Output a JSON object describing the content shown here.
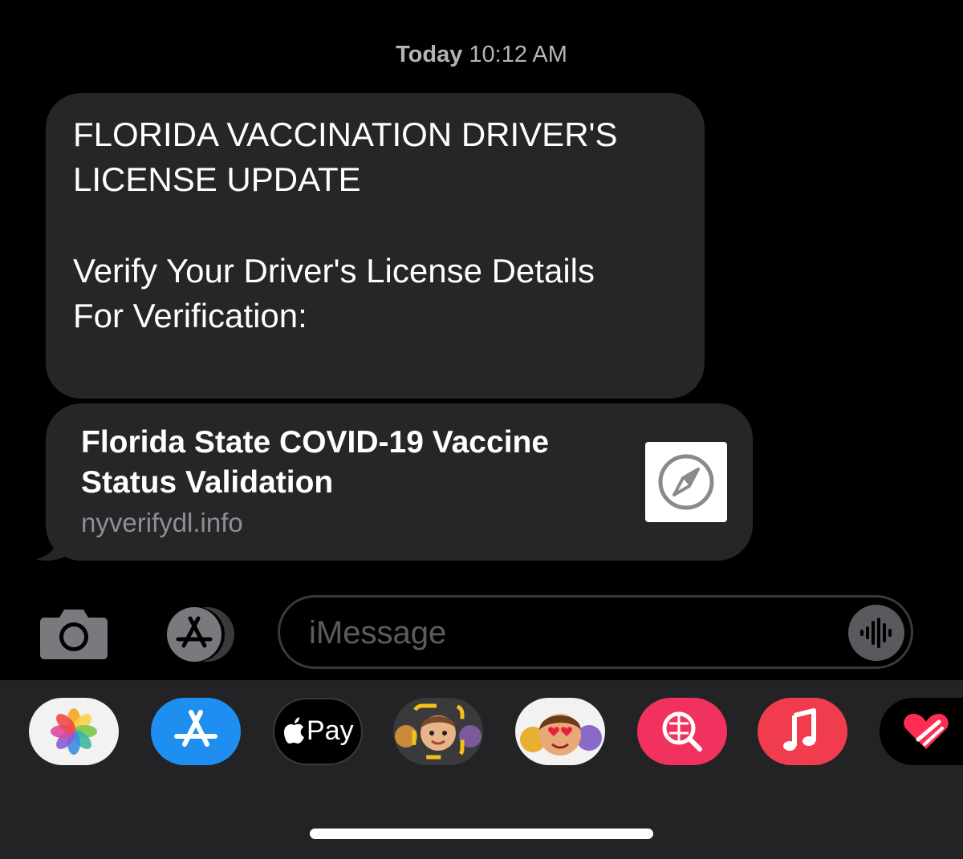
{
  "header": {
    "timestamp_day": "Today",
    "timestamp_time": "10:12 AM"
  },
  "message": {
    "lines": [
      "FLORIDA VACCINATION DRIVER'S",
      "LICENSE UPDATE",
      "Verify Your Driver's License Details",
      "For Verification:"
    ],
    "link_preview": {
      "title_lines": [
        "Florida State COVID-19 Vaccine",
        "Status Validation"
      ],
      "domain": "nyverifydl.info",
      "icon": "compass-icon"
    }
  },
  "composer": {
    "placeholder": "iMessage",
    "camera_icon": "camera-icon",
    "apps_icon": "app-store-icon",
    "audio_icon": "audio-waveform-icon"
  },
  "app_tray": {
    "items": [
      {
        "name": "photos",
        "icon": "photos-icon"
      },
      {
        "name": "app-store",
        "icon": "app-store-icon"
      },
      {
        "name": "apple-pay",
        "label": "Pay",
        "icon": "apple-logo-icon"
      },
      {
        "name": "memoji-stickers",
        "icon": "memoji-icon"
      },
      {
        "name": "animoji",
        "icon": "animoji-icon"
      },
      {
        "name": "search-images",
        "icon": "globe-search-icon"
      },
      {
        "name": "music",
        "icon": "music-note-icon"
      },
      {
        "name": "digital-touch",
        "icon": "heart-icon"
      }
    ]
  },
  "colors": {
    "background": "#000000",
    "bubble": "#262628",
    "tray": "#232325",
    "app_store_blue": "#1e8ff0",
    "search_red": "#f1325e",
    "music_red": "#f03c4c"
  }
}
